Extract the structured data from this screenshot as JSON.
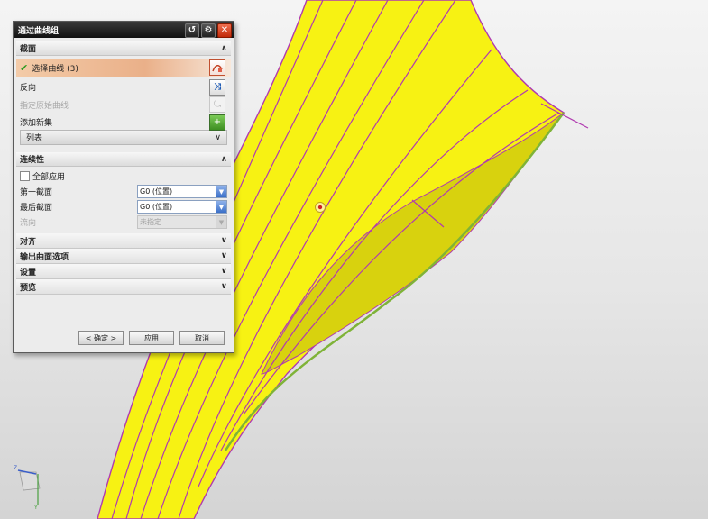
{
  "dialog": {
    "title": "通过曲线组",
    "sections": {
      "section_title": "截面",
      "select_curve": "选择曲线 (3)",
      "reverse": "反向",
      "specify_origin": "指定原始曲线",
      "add_set": "添加新集",
      "list": "列表"
    },
    "continuity": {
      "title": "连续性",
      "apply_all": "全部应用",
      "first_section": "第一截面",
      "first_section_value": "G0 (位置)",
      "last_section": "最后截面",
      "last_section_value": "G0 (位置)",
      "flow_direction": "流向",
      "flow_direction_value": "未指定"
    },
    "collapsed": {
      "align": "对齐",
      "output": "输出曲面选项",
      "settings": "设置",
      "preview": "预览"
    },
    "buttons": {
      "ok": "< 确定 >",
      "apply": "应用",
      "cancel": "取消"
    }
  },
  "colors": {
    "surface": "#f7f213",
    "surface_shade": "#c9c40a",
    "curve": "#b03ab0",
    "edge_green": "#7fb338",
    "titlebar": "#1a1a1a",
    "selection": "#eab089"
  },
  "icons": [
    "reset-icon",
    "gear-icon",
    "close-icon",
    "curve-select-icon",
    "reverse-icon",
    "origin-curve-icon",
    "add-set-icon",
    "collapse-up-icon",
    "expand-down-icon",
    "combo-arrow-icon",
    "wcs-triad-icon",
    "origin-marker-icon"
  ]
}
